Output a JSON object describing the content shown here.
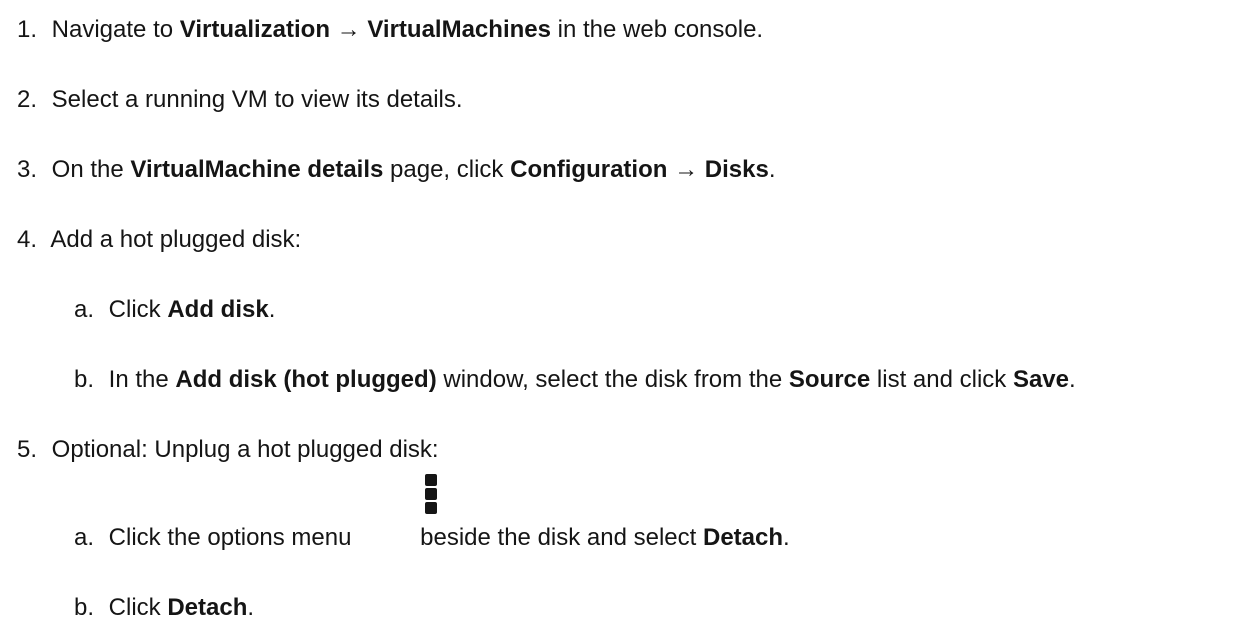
{
  "steps": [
    {
      "num": "1.",
      "parts": [
        "Navigate to ",
        "Virtualization",
        " → ",
        "VirtualMachines",
        " in the web console."
      ]
    },
    {
      "num": "2.",
      "parts": [
        "Select a running VM to view its details."
      ]
    },
    {
      "num": "3.",
      "parts": [
        "On the ",
        "VirtualMachine details",
        " page, click ",
        "Configuration",
        " → ",
        "Disks",
        "."
      ]
    },
    {
      "num": "4.",
      "parts": [
        "Add a hot plugged disk:"
      ],
      "sub": [
        {
          "num": "a.",
          "parts": [
            "Click ",
            "Add disk",
            "."
          ]
        },
        {
          "num": "b.",
          "parts": [
            "In the ",
            "Add disk (hot plugged)",
            " window, select the disk from the ",
            "Source",
            " list and click ",
            "Save",
            "."
          ]
        }
      ]
    },
    {
      "num": "5.",
      "parts": [
        "Optional: Unplug a hot plugged disk:"
      ],
      "sub": [
        {
          "num": "a.",
          "parts": [
            "Click the options menu ",
            "beside the disk and select ",
            "Detach",
            "."
          ]
        },
        {
          "num": "b.",
          "parts": [
            "Click ",
            "Detach",
            "."
          ]
        }
      ]
    }
  ],
  "icons": {
    "options_menu": "kebab-vertical-icon"
  }
}
